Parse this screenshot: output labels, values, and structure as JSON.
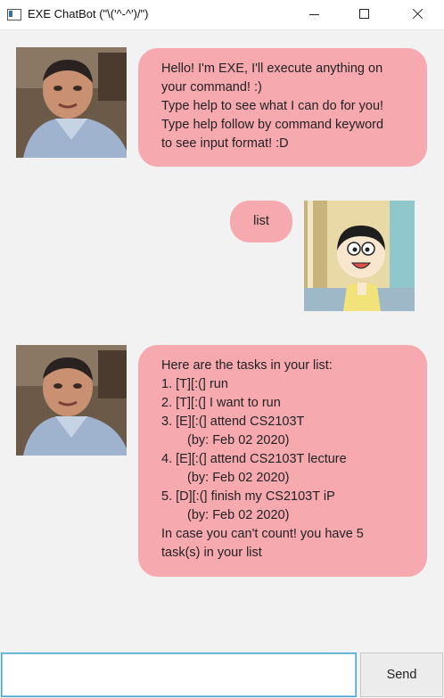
{
  "window": {
    "title": "EXE ChatBot (\"\\('^-^')/\")"
  },
  "chat": {
    "messages": [
      {
        "sender": "bot",
        "avatar": "bot-person-photo",
        "lines": [
          "Hello! I'm EXE, I'll execute anything on",
          "your command! :)",
          "Type help to see what I can do for you!",
          "Type help follow by command keyword",
          "to see input format! :D"
        ]
      },
      {
        "sender": "user",
        "avatar": "user-cartoon-boy",
        "lines": [
          "list"
        ]
      },
      {
        "sender": "bot",
        "avatar": "bot-person-photo",
        "lines": [
          "Here are the tasks in your list:",
          "1. [T][:(] run",
          "2. [T][:(] I want to run",
          "3. [E][:(] attend CS2103T",
          "(by: Feb 02 2020)",
          "4. [E][:(] attend CS2103T lecture",
          "(by: Feb 02 2020)",
          "5. [D][:(] finish my CS2103T iP",
          "(by: Feb 02 2020)",
          "In case you can't count! you have 5",
          "task(s) in your list"
        ]
      }
    ]
  },
  "input": {
    "value": "",
    "send_label": "Send"
  }
}
